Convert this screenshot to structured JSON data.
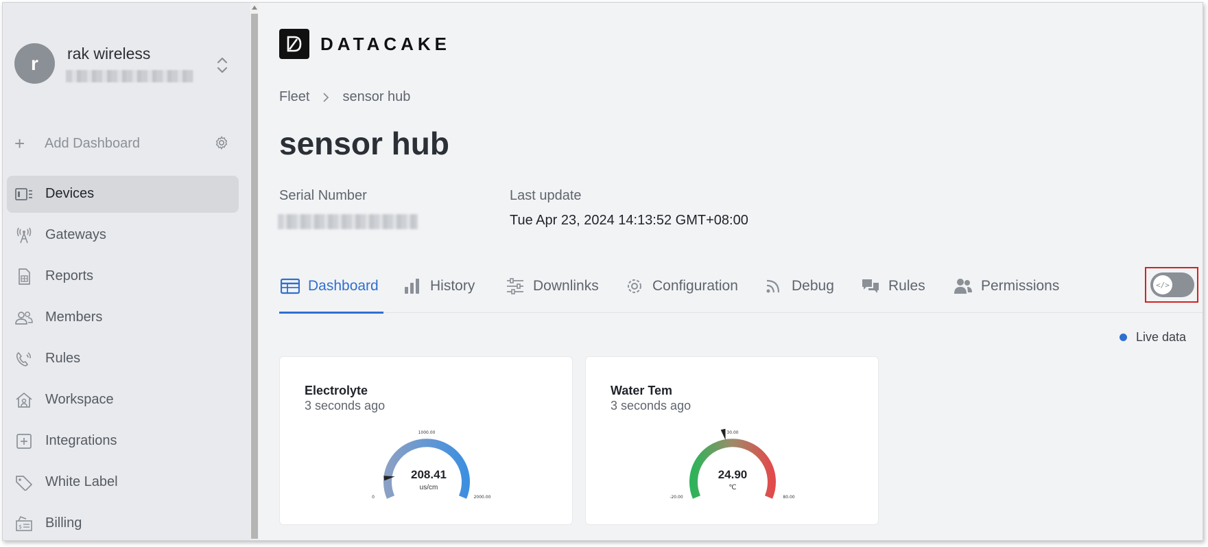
{
  "sidebar": {
    "org": {
      "avatar_letter": "r",
      "name": "rak wireless"
    },
    "add_dashboard": "Add Dashboard",
    "items": [
      {
        "label": "Devices",
        "icon": "devices-icon",
        "active": true
      },
      {
        "label": "Gateways",
        "icon": "gateway-icon",
        "active": false
      },
      {
        "label": "Reports",
        "icon": "reports-icon",
        "active": false
      },
      {
        "label": "Members",
        "icon": "members-icon",
        "active": false
      },
      {
        "label": "Rules",
        "icon": "rules-icon",
        "active": false
      },
      {
        "label": "Workspace",
        "icon": "workspace-icon",
        "active": false
      },
      {
        "label": "Integrations",
        "icon": "integrations-icon",
        "active": false
      },
      {
        "label": "White Label",
        "icon": "tag-icon",
        "active": false
      },
      {
        "label": "Billing",
        "icon": "billing-icon",
        "active": false
      }
    ]
  },
  "header": {
    "logo_text": "DATACAKE"
  },
  "breadcrumb": {
    "parent": "Fleet",
    "current": "sensor hub"
  },
  "page": {
    "title": "sensor hub",
    "serial_label": "Serial Number",
    "last_update_label": "Last update",
    "last_update_value": "Tue Apr 23, 2024 14:13:52 GMT+08:00"
  },
  "tabs": [
    {
      "label": "Dashboard",
      "icon": "table-icon",
      "active": true
    },
    {
      "label": "History",
      "icon": "bar-chart-icon",
      "active": false
    },
    {
      "label": "Downlinks",
      "icon": "sliders-icon",
      "active": false
    },
    {
      "label": "Configuration",
      "icon": "gear-icon",
      "active": false
    },
    {
      "label": "Debug",
      "icon": "rss-icon",
      "active": false
    },
    {
      "label": "Rules",
      "icon": "comments-icon",
      "active": false
    },
    {
      "label": "Permissions",
      "icon": "users-icon",
      "active": false
    }
  ],
  "toggle": {
    "knob_glyph": "</>",
    "on": false
  },
  "live_data": "Live data",
  "widgets": [
    {
      "title": "Electrolyte",
      "subtitle": "3 seconds ago",
      "value": "208.41",
      "unit": "us/cm",
      "min_label": "0",
      "mid_label": "1000.00",
      "max_label": "2000.00",
      "min": 0,
      "max": 2000,
      "reading": 208.41
    },
    {
      "title": "Water Tem",
      "subtitle": "3 seconds ago",
      "value": "24.90",
      "unit": "℃",
      "min_label": "-20.00",
      "mid_label": "30.00",
      "max_label": "80.00",
      "min": -20,
      "max": 80,
      "reading": 24.9
    }
  ],
  "colors": {
    "accent": "#2f6fd0",
    "highlight_box": "#d62020"
  }
}
